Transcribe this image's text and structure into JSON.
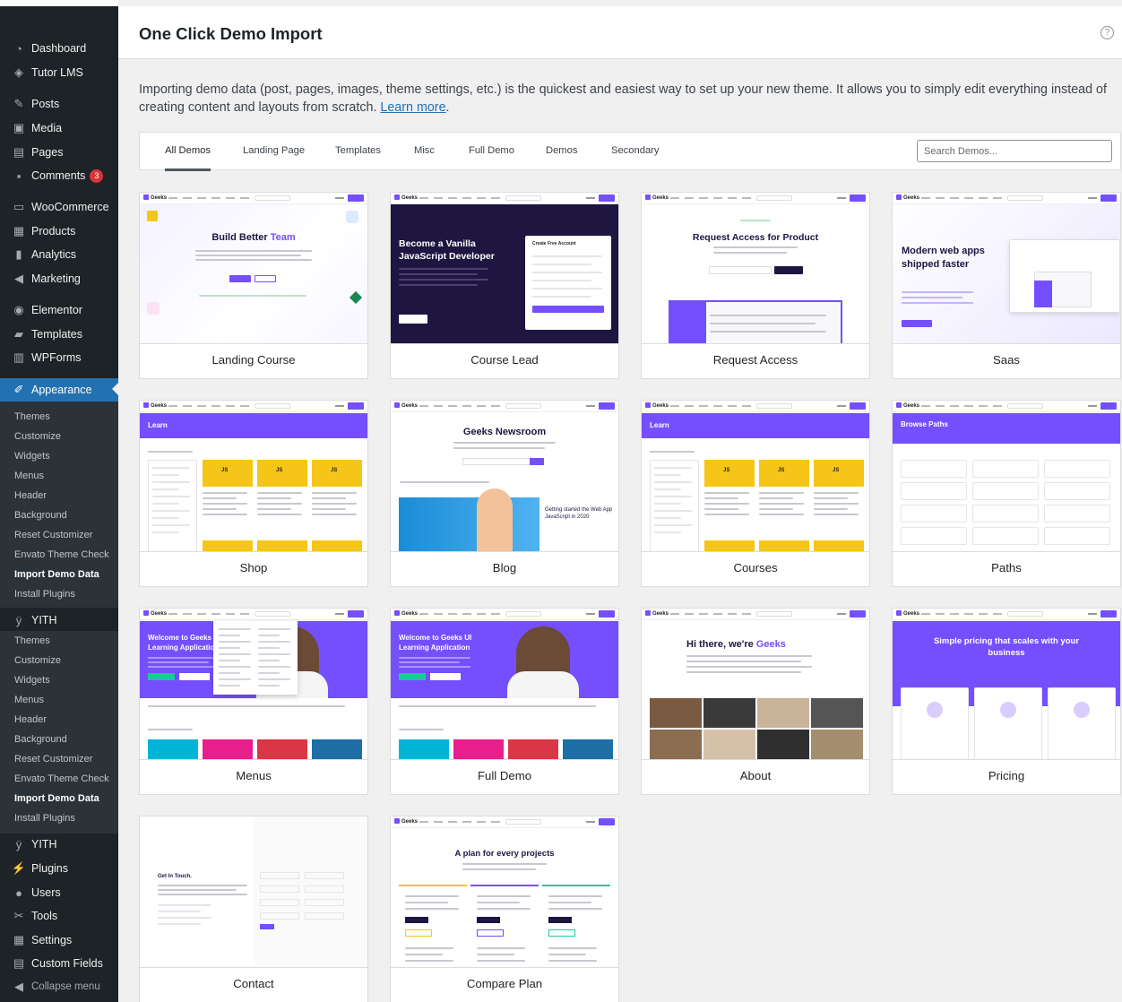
{
  "sidebar": {
    "items": [
      {
        "label": "Dashboard",
        "icon": "dashboard-icon",
        "glyph": "◔"
      },
      {
        "label": "Tutor LMS",
        "icon": "tutor-lms-icon",
        "glyph": "◈"
      },
      {
        "label": "Posts",
        "icon": "pin-icon",
        "glyph": "✎"
      },
      {
        "label": "Media",
        "icon": "media-icon",
        "glyph": "▣"
      },
      {
        "label": "Pages",
        "icon": "pages-icon",
        "glyph": "▤"
      },
      {
        "label": "Comments",
        "icon": "comments-icon",
        "glyph": "▪",
        "badge": "3"
      },
      {
        "label": "WooCommerce",
        "icon": "woocommerce-icon",
        "glyph": "▭"
      },
      {
        "label": "Products",
        "icon": "products-icon",
        "glyph": "▦"
      },
      {
        "label": "Analytics",
        "icon": "analytics-icon",
        "glyph": "▮"
      },
      {
        "label": "Marketing",
        "icon": "megaphone-icon",
        "glyph": "◀"
      },
      {
        "label": "Elementor",
        "icon": "elementor-icon",
        "glyph": "◉"
      },
      {
        "label": "Templates",
        "icon": "folder-icon",
        "glyph": "▰"
      },
      {
        "label": "WPForms",
        "icon": "wpforms-icon",
        "glyph": "▥"
      },
      {
        "label": "Appearance",
        "icon": "paintbrush-icon",
        "glyph": "✐"
      }
    ],
    "appearance_submenu": [
      "Themes",
      "Customize",
      "Widgets",
      "Menus",
      "Header",
      "Background",
      "Reset Customizer",
      "Envato Theme Check",
      "Import Demo Data",
      "Install Plugins"
    ],
    "yith_label": "YITH",
    "yith_submenu": [
      "Themes",
      "Customize",
      "Widgets",
      "Menus",
      "Header",
      "Background",
      "Reset Customizer",
      "Envato Theme Check",
      "Import Demo Data",
      "Install Plugins"
    ],
    "bottom_items": [
      {
        "label": "YITH",
        "icon": "yith-icon",
        "glyph": "ÿ"
      },
      {
        "label": "Plugins",
        "icon": "plugins-icon",
        "glyph": "⚡"
      },
      {
        "label": "Users",
        "icon": "users-icon",
        "glyph": "●"
      },
      {
        "label": "Tools",
        "icon": "wrench-icon",
        "glyph": "✂"
      },
      {
        "label": "Settings",
        "icon": "settings-icon",
        "glyph": "▦"
      },
      {
        "label": "Custom Fields",
        "icon": "custom-fields-icon",
        "glyph": "▤"
      },
      {
        "label": "Collapse menu",
        "icon": "collapse-icon",
        "glyph": "◀"
      }
    ]
  },
  "header": {
    "title": "One Click Demo Import",
    "help": "?"
  },
  "intro": {
    "text": "Importing demo data (post, pages, images, theme settings, etc.) is the quickest and easiest way to set up your new theme. It allows you to simply edit everything instead of creating content and layouts from scratch.",
    "link": "Learn more"
  },
  "tabs": [
    "All Demos",
    "Landing Page",
    "Templates",
    "Misc",
    "Full Demo",
    "Demos",
    "Secondary"
  ],
  "search": {
    "placeholder": "Search Demos..."
  },
  "demos": [
    {
      "name": "Landing Course",
      "headline": "Build Better",
      "headline_accent": "Team"
    },
    {
      "name": "Course Lead",
      "headline": "Become a Vanilla JavaScript Developer",
      "form_title": "Create Free Account"
    },
    {
      "name": "Request Access",
      "headline": "Request Access for Product"
    },
    {
      "name": "Saas",
      "headline": "Modern web apps shipped faster"
    },
    {
      "name": "Shop",
      "headline": "Learn"
    },
    {
      "name": "Blog",
      "headline": "Geeks Newsroom",
      "post_title": "Getting started the Web App JavaScript in 2020"
    },
    {
      "name": "Courses",
      "headline": "Learn"
    },
    {
      "name": "Paths",
      "headline": "Browse Paths"
    },
    {
      "name": "Menus",
      "headline": "Welcome to Geeks UI Learning Application"
    },
    {
      "name": "Full Demo",
      "headline": "Welcome to Geeks UI Learning Application"
    },
    {
      "name": "About",
      "headline": "Hi there, we're",
      "headline_accent": "Geeks"
    },
    {
      "name": "Pricing",
      "headline": "Simple pricing that scales with your business"
    },
    {
      "name": "Contact",
      "headline": "Get In Touch."
    },
    {
      "name": "Compare Plan",
      "headline": "A plan for every projects"
    }
  ],
  "colors": {
    "sidebar": "#1d2327",
    "active": "#2271b1",
    "accent": "#754ffe",
    "badge": "#d63638"
  }
}
